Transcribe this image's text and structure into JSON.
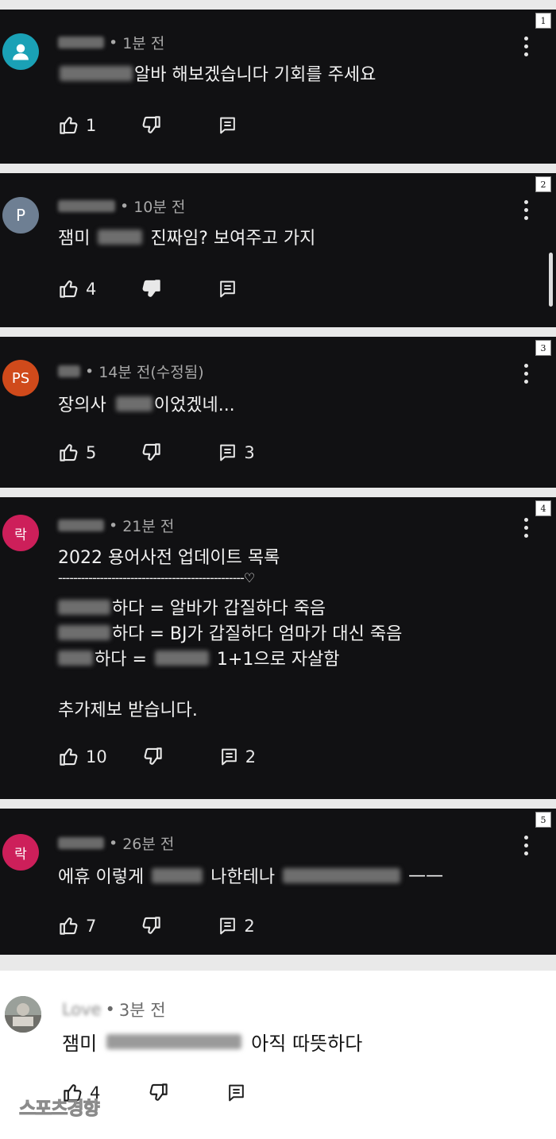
{
  "comments": [
    {
      "index": "1",
      "avatar_letter": "",
      "avatar_color": "#1aa1b6",
      "time": "1분 전",
      "text_after": "알바 해보겠습니다 기회를 주세요",
      "likes": "1",
      "replies": ""
    },
    {
      "index": "2",
      "avatar_letter": "P",
      "avatar_color": "#6e7f93",
      "time": "10분 전",
      "text_before": "잼미",
      "text_after": "진짜임? 보여주고 가지",
      "likes": "4",
      "replies": ""
    },
    {
      "index": "3",
      "avatar_letter": "PS",
      "avatar_color": "#d04a1b",
      "time": "14분 전(수정됨)",
      "text_before": "장의사",
      "text_after": "이었겠네...",
      "likes": "5",
      "replies": "3"
    },
    {
      "index": "4",
      "avatar_letter": "락",
      "avatar_color": "#cd1f5a",
      "time": "21분 전",
      "title": "2022 용어사전 업데이트 목록",
      "divider": "-------------------------------------------------♡",
      "entry1": "하다 = 알바가 갑질하다 죽음",
      "entry2": "하다 = BJ가 갑질하다 엄마가 대신 죽음",
      "entry3_mid": "하다 =",
      "entry3_after": "1+1으로 자살함",
      "footer": "추가제보 받습니다.",
      "likes": "10",
      "replies": "2"
    },
    {
      "index": "5",
      "avatar_letter": "락",
      "avatar_color": "#cd1f5a",
      "time": "26분 전",
      "text_before": "에휴 이렇게",
      "text_mid": "나한테나",
      "text_after": "——",
      "likes": "7",
      "replies": "2"
    },
    {
      "name": "Love",
      "time": "3분 전",
      "text_before": "잼미",
      "text_after": "아직 따뜻하다",
      "likes": "4",
      "replies": ""
    }
  ],
  "separator": "•",
  "watermark": "스포츠경향"
}
